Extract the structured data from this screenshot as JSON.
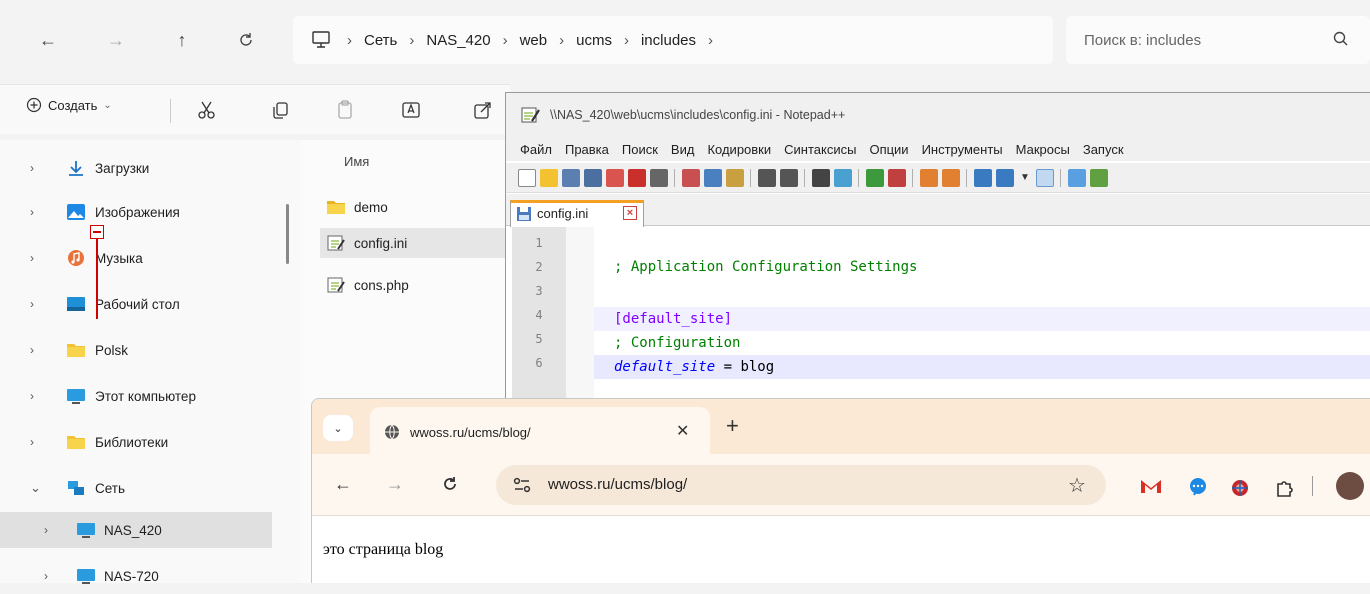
{
  "explorer": {
    "breadcrumb": [
      "Сеть",
      "NAS_420",
      "web",
      "ucms",
      "includes"
    ],
    "search_placeholder": "Поиск в: includes",
    "toolbar": {
      "create_label": "Создать"
    },
    "nav": [
      {
        "label": "Загрузки",
        "icon": "download-icon"
      },
      {
        "label": "Изображения",
        "icon": "pictures-icon"
      },
      {
        "label": "Музыка",
        "icon": "music-icon"
      },
      {
        "label": "Рабочий стол",
        "icon": "desktop-icon"
      },
      {
        "label": "Polsk",
        "icon": "folder-icon"
      },
      {
        "label": "Этот компьютер",
        "icon": "computer-icon"
      },
      {
        "label": "Библиотеки",
        "icon": "folder-icon"
      },
      {
        "label": "Сеть",
        "icon": "network-icon"
      },
      {
        "label": "NAS_420",
        "icon": "computer-icon"
      },
      {
        "label": "NAS-720",
        "icon": "computer-icon"
      }
    ],
    "column_name": "Имя",
    "files": [
      {
        "label": "demo",
        "icon": "folder-icon"
      },
      {
        "label": "config.ini",
        "icon": "ini-file-icon"
      },
      {
        "label": "cons.php",
        "icon": "php-file-icon"
      }
    ]
  },
  "notepad": {
    "title": "\\\\NAS_420\\web\\ucms\\includes\\config.ini - Notepad++",
    "menu": [
      "Файл",
      "Правка",
      "Поиск",
      "Вид",
      "Кодировки",
      "Синтаксисы",
      "Опции",
      "Инструменты",
      "Макросы",
      "Запуск"
    ],
    "tab_label": "config.ini",
    "lines": [
      {
        "num": "1",
        "text": ""
      },
      {
        "num": "2",
        "text": "; Application Configuration Settings"
      },
      {
        "num": "3",
        "text": ""
      },
      {
        "num": "4",
        "text": "[default_site]"
      },
      {
        "num": "5",
        "text": "; Configuration"
      },
      {
        "num": "6",
        "key": "default_site",
        "eq": " = ",
        "value": "blog"
      }
    ]
  },
  "chrome": {
    "tab_title": "wwoss.ru/ucms/blog/",
    "url": "wwoss.ru/ucms/blog/",
    "page_text": "это страница blog"
  }
}
